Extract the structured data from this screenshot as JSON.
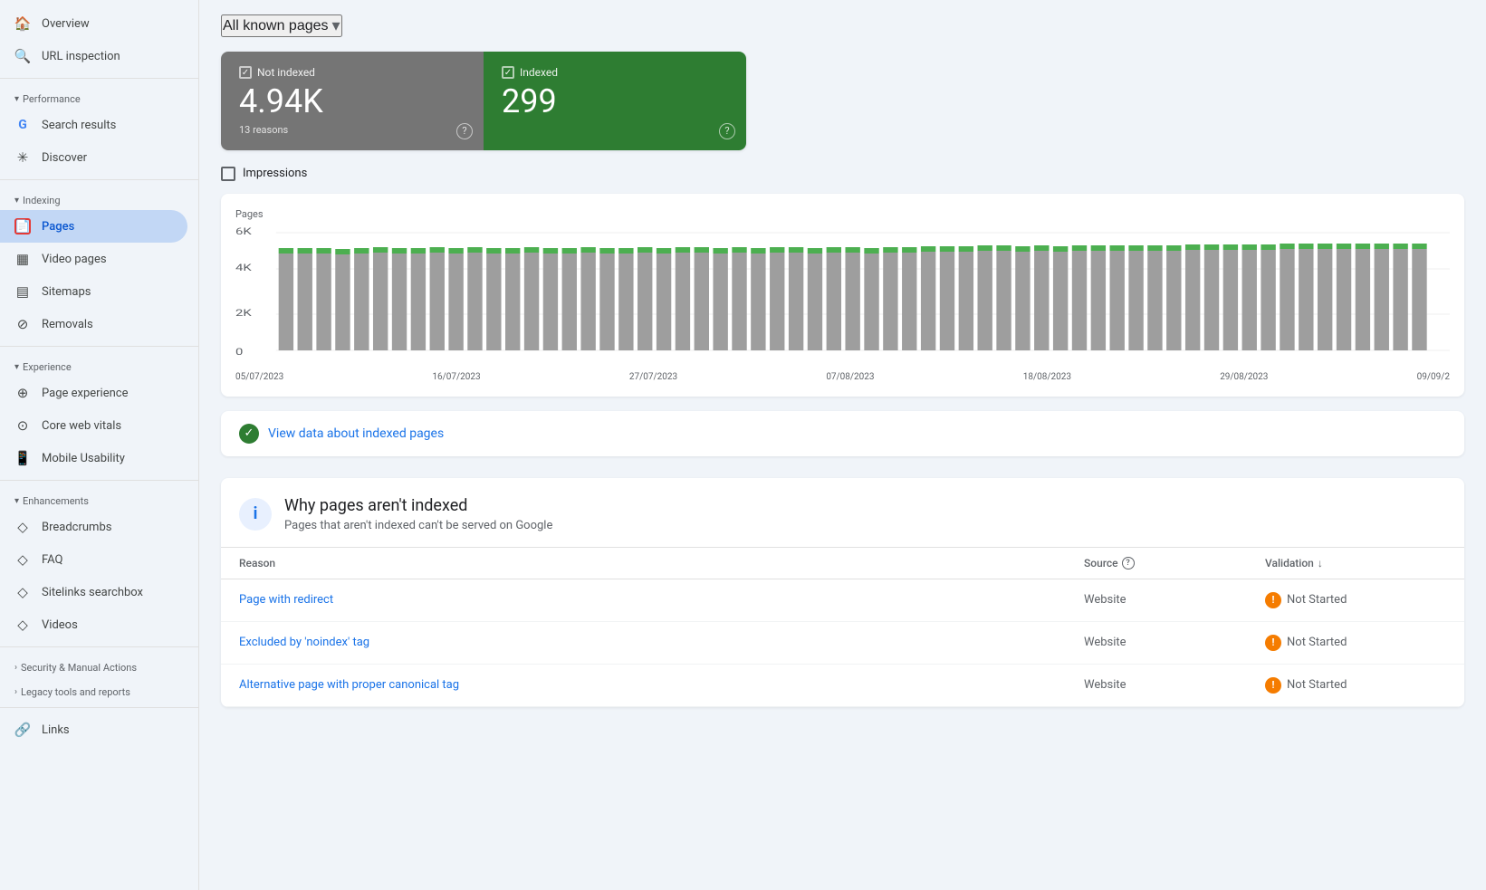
{
  "sidebar": {
    "items": [
      {
        "id": "overview",
        "label": "Overview",
        "icon": "🏠",
        "active": false
      },
      {
        "id": "url-inspection",
        "label": "URL inspection",
        "icon": "🔍",
        "active": false
      }
    ],
    "sections": [
      {
        "id": "performance",
        "label": "Performance",
        "collapsed": false,
        "items": [
          {
            "id": "search-results",
            "label": "Search results",
            "icon": "G",
            "active": false
          },
          {
            "id": "discover",
            "label": "Discover",
            "icon": "✳",
            "active": false
          }
        ]
      },
      {
        "id": "indexing",
        "label": "Indexing",
        "collapsed": false,
        "items": [
          {
            "id": "pages",
            "label": "Pages",
            "icon": "📄",
            "active": true
          },
          {
            "id": "video-pages",
            "label": "Video pages",
            "icon": "▦",
            "active": false
          },
          {
            "id": "sitemaps",
            "label": "Sitemaps",
            "icon": "▤",
            "active": false
          },
          {
            "id": "removals",
            "label": "Removals",
            "icon": "⊘",
            "active": false
          }
        ]
      },
      {
        "id": "experience",
        "label": "Experience",
        "collapsed": false,
        "items": [
          {
            "id": "page-experience",
            "label": "Page experience",
            "icon": "⊕",
            "active": false
          },
          {
            "id": "core-web-vitals",
            "label": "Core web vitals",
            "icon": "⊙",
            "active": false
          },
          {
            "id": "mobile-usability",
            "label": "Mobile Usability",
            "icon": "📱",
            "active": false
          }
        ]
      },
      {
        "id": "enhancements",
        "label": "Enhancements",
        "collapsed": false,
        "items": [
          {
            "id": "breadcrumbs",
            "label": "Breadcrumbs",
            "icon": "◇",
            "active": false
          },
          {
            "id": "faq",
            "label": "FAQ",
            "icon": "◇",
            "active": false
          },
          {
            "id": "sitelinks-searchbox",
            "label": "Sitelinks searchbox",
            "icon": "◇",
            "active": false
          },
          {
            "id": "videos",
            "label": "Videos",
            "icon": "◇",
            "active": false
          }
        ]
      },
      {
        "id": "security",
        "label": "Security & Manual Actions",
        "collapsed": true,
        "items": []
      },
      {
        "id": "legacy",
        "label": "Legacy tools and reports",
        "collapsed": true,
        "items": []
      }
    ],
    "bottom_items": [
      {
        "id": "links",
        "label": "Links",
        "icon": "🔗"
      }
    ]
  },
  "header": {
    "dropdown_label": "All known pages",
    "dropdown_arrow": "▾"
  },
  "index_cards": {
    "not_indexed": {
      "label": "Not indexed",
      "value": "4.94K",
      "subtitle": "13 reasons",
      "help_label": "?"
    },
    "indexed": {
      "label": "Indexed",
      "value": "299",
      "help_label": "?"
    }
  },
  "impressions": {
    "label": "Impressions"
  },
  "chart": {
    "y_label": "Pages",
    "y_max": "6K",
    "y_mid": "4K",
    "y_low": "2K",
    "y_zero": "0",
    "x_labels": [
      "05/07/2023",
      "16/07/2023",
      "27/07/2023",
      "07/08/2023",
      "18/08/2023",
      "29/08/2023",
      "09/09/2"
    ]
  },
  "view_data": {
    "label": "View data about indexed pages"
  },
  "not_indexed_section": {
    "title": "Why pages aren't indexed",
    "subtitle": "Pages that aren't indexed can't be served on Google",
    "table": {
      "col_reason": "Reason",
      "col_source": "Source",
      "col_source_help": "?",
      "col_validation": "Validation",
      "rows": [
        {
          "reason": "Page with redirect",
          "source": "Website",
          "validation": "Not Started",
          "validation_status": "warning"
        },
        {
          "reason": "Excluded by 'noindex' tag",
          "source": "Website",
          "validation": "Not Started",
          "validation_status": "warning"
        },
        {
          "reason": "Alternative page with proper canonical tag",
          "source": "Website",
          "validation": "Not Started",
          "validation_status": "warning"
        }
      ]
    }
  },
  "colors": {
    "not_indexed_bg": "#757575",
    "indexed_bg": "#2e7d32",
    "active_item_bg": "#c2d7f5",
    "active_item_text": "#0b57d0",
    "link_color": "#1a73e8",
    "warning_color": "#f57c00"
  }
}
